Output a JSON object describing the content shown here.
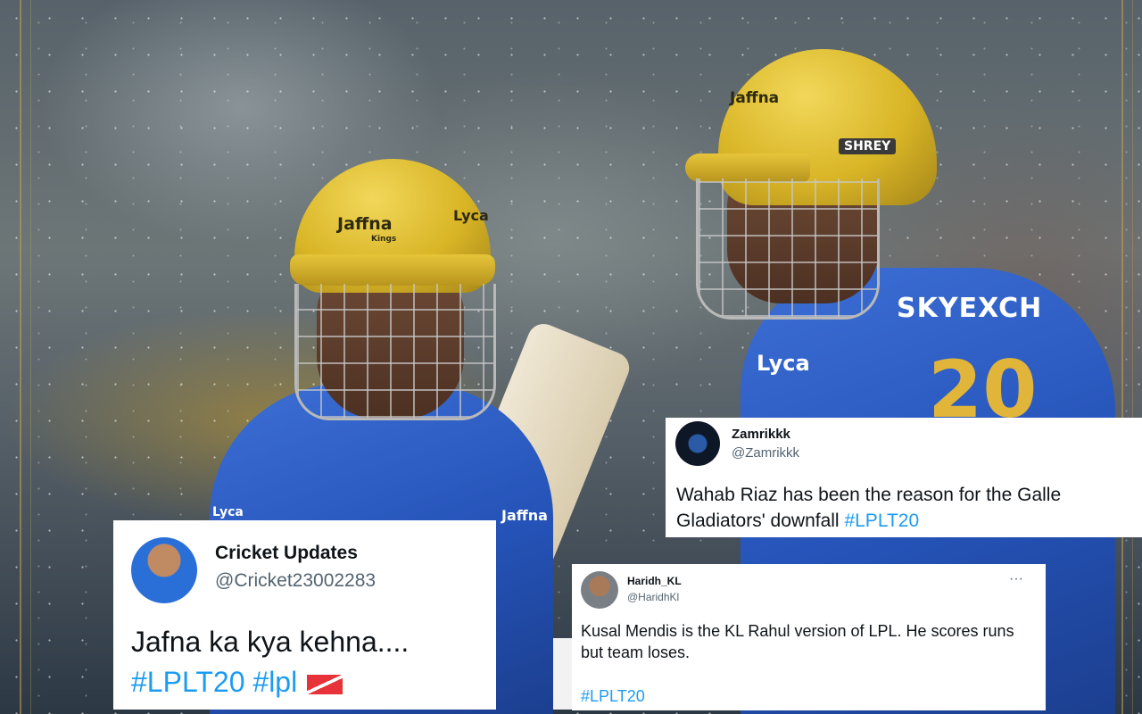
{
  "background": {
    "jersey_color": "#2553b8",
    "helmet_color": "#d9b526"
  },
  "players": {
    "left": {
      "helmet_logo": "Jaffna",
      "helmet_logo_sub": "Kings",
      "helmet_side": "Lyca",
      "jersey_logo": "Jaffna",
      "jersey_chest": "Lyca"
    },
    "right": {
      "helmet_logo": "Jaffna",
      "helmet_badge": "SHREY",
      "jersey_sponsor": "SKYEXCH",
      "jersey_lyca": "Lyca",
      "jersey_number": "20"
    }
  },
  "tweets": [
    {
      "name": "Cricket Updates",
      "handle": "@Cricket23002283",
      "body": "Jafna ka kya kehna....",
      "hashtags": [
        "#LPLT20",
        "#lpl"
      ],
      "flag_icon": "flag-emoji"
    },
    {
      "name": "Zamrikkk",
      "handle": "@Zamrikkk",
      "body": "Wahab Riaz has been the reason for the Galle Gladiators' downfall",
      "hashtag": "#LPLT20"
    },
    {
      "name": "Haridh_KL",
      "handle": "@HaridhKl",
      "more": "···",
      "body": "Kusal Mendis is the KL Rahul version of LPL. He scores runs but team loses.",
      "hashtag": "#LPLT20"
    }
  ],
  "colors": {
    "hashtag": "#1d9bf0",
    "handle": "#536471",
    "text": "#0f1419"
  }
}
